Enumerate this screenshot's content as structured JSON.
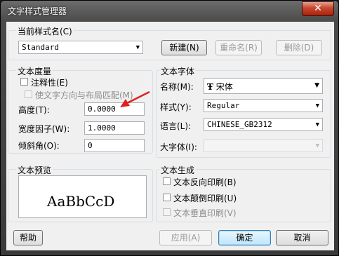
{
  "window": {
    "title": "文字样式管理器",
    "close_glyph": "✕"
  },
  "current_style": {
    "label": "当前样式名(C)",
    "value": "Standard",
    "new_btn": "新建(N)",
    "rename_btn": "重命名(R)",
    "delete_btn": "删除(D)"
  },
  "metrics": {
    "title": "文本度量",
    "annotative_label": "注释性(E)",
    "annotative_checked": false,
    "match_label": "使文字方向与布局匹配(M)",
    "match_checked": false,
    "height_label": "高度(T):",
    "height_value": "0.0000",
    "width_label": "宽度因子(W):",
    "width_value": "1.0000",
    "oblique_label": "倾斜角(O):",
    "oblique_value": "0"
  },
  "font": {
    "title": "文本字体",
    "name_label": "名称(M):",
    "name_value": "宋体",
    "name_icon": "truetype-font-icon",
    "style_label": "样式(Y):",
    "style_value": "Regular",
    "lang_label": "语言(L):",
    "lang_value": "CHINESE_GB2312",
    "bigfont_label": "大字体(I):",
    "bigfont_value": ""
  },
  "preview": {
    "title": "文本预览",
    "sample": "AaBbCcD"
  },
  "generation": {
    "title": "文本生成",
    "reverse_label": "文本反向印刷(B)",
    "reverse_checked": false,
    "upside_label": "文本颠倒印刷(U)",
    "upside_checked": false,
    "vertical_label": "文本垂直印刷(V)",
    "vertical_checked": false
  },
  "buttons": {
    "help": "帮助",
    "apply": "应用(A)",
    "ok": "确定",
    "cancel": "取消"
  },
  "colors": {
    "annotation_arrow": "#e02020"
  }
}
